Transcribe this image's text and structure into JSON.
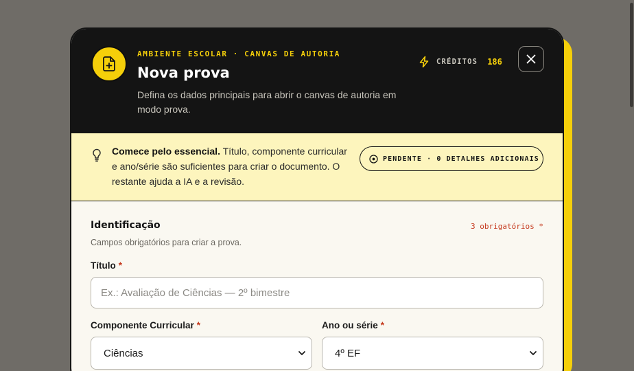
{
  "modal": {
    "eyebrow": "AMBIENTE ESCOLAR · CANVAS DE AUTORIA",
    "title": "Nova prova",
    "subtitle": "Defina os dados principais para abrir o canvas de autoria em modo prova.",
    "credits_label": "CRÉDITOS",
    "credits_value": "186",
    "header_icon": "file-plus-icon",
    "close_icon": "close-icon"
  },
  "tip": {
    "icon": "lightbulb-icon",
    "bold": "Comece pelo essencial.",
    "text": " Título, componente curricular e ano/série são suficientes para criar o documento. O restante ajuda a IA e a revisão.",
    "pending_label": "PENDENTE · 0 DETALHES ADICIONAIS"
  },
  "section": {
    "title": "Identificação",
    "badge": "3 obrigatórios *",
    "description": "Campos obrigatórios para criar a prova."
  },
  "fields": {
    "titulo_label": "Título",
    "titulo_placeholder": "Ex.: Avaliação de Ciências — 2º bimestre",
    "componente_label": "Componente Curricular",
    "componente_value": "Ciências",
    "ano_label": "Ano ou série",
    "ano_value": "4º EF",
    "required_mark": "*"
  },
  "colors": {
    "accent": "#f5cf0a",
    "header_bg": "#141414",
    "tip_bg": "#fdf5bd",
    "required": "#c53a1e"
  }
}
